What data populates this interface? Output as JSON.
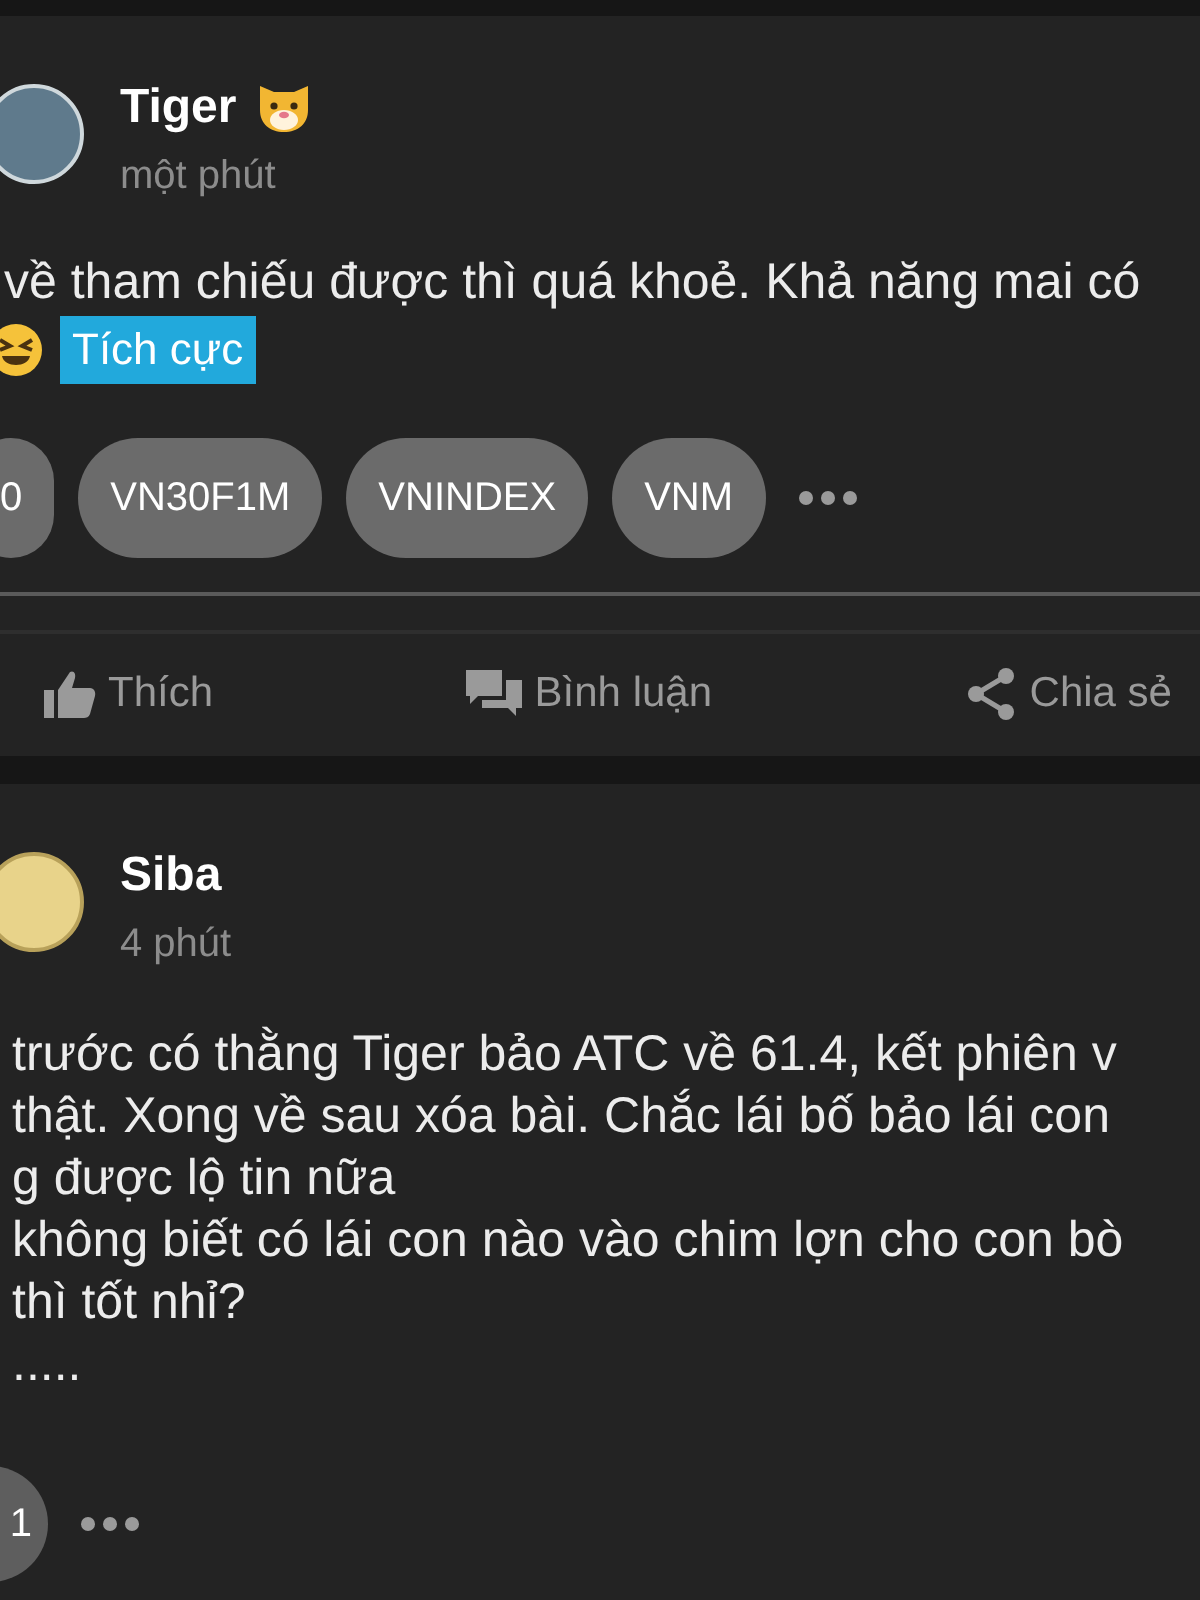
{
  "posts": [
    {
      "author": "Tiger",
      "author_badge": true,
      "time": "một phút",
      "lines": [
        "về tham chiếu được thì quá khoẻ. Khả năng mai có"
      ],
      "sentiment": "Tích cực",
      "tags": [
        "0",
        "VN30F1M",
        "VNINDEX",
        "VNM"
      ],
      "actions": [
        {
          "kind": "like",
          "label": "Thích"
        },
        {
          "kind": "comment",
          "label": "Bình luận"
        },
        {
          "kind": "share",
          "label": "Chia sẻ"
        }
      ]
    },
    {
      "author": "Siba",
      "author_badge": false,
      "time": "4 phút",
      "lines": [
        "trước có thằng Tiger bảo ATC về 61.4, kết phiên v",
        "thật. Xong về sau xóa bài. Chắc lái bố bảo lái con",
        "g được lộ tin nữa",
        "không biết có lái con nào vào chim lợn cho con bò",
        "thì tốt nhỉ?",
        "....."
      ],
      "reaction_count": "1"
    }
  ]
}
